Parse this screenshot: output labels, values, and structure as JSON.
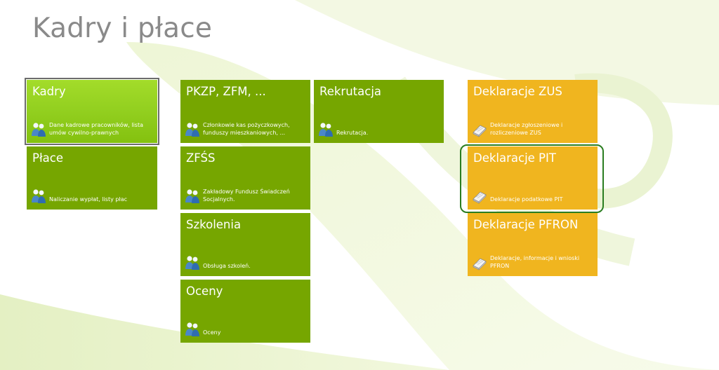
{
  "page": {
    "title": "Kadry i płace"
  },
  "colors": {
    "green_tile": "#76a600",
    "green_tile_active": "#92cf1f",
    "yellow_tile": "#f0b51f",
    "title_text": "#8a8a8a",
    "focus_ring": "#2a7d20"
  },
  "icons": {
    "people": "people-icon",
    "book": "book-icon"
  },
  "tiles": {
    "kadry": {
      "title": "Kadry",
      "desc": "Dane kadrowe pracowników, lista umów cywilno-prawnych"
    },
    "place": {
      "title": "Płace",
      "desc": "Naliczanie wypłat, listy płac"
    },
    "pkzp": {
      "title": "PKZP, ZFM, ...",
      "desc": "Członkowie kas pożyczkowych, funduszy mieszkaniowych, ..."
    },
    "zfss": {
      "title": "ZFŚS",
      "desc": "Zakładowy Fundusz Świadczeń Socjalnych."
    },
    "szkolenia": {
      "title": "Szkolenia",
      "desc": "Obsługa szkoleń."
    },
    "oceny": {
      "title": "Oceny",
      "desc": "Oceny"
    },
    "rekrutacja": {
      "title": "Rekrutacja",
      "desc": "Rekrutacja."
    },
    "zus": {
      "title": "Deklaracje ZUS",
      "desc": "Deklaracje zgłoszeniowe i rozliczeniowe ZUS"
    },
    "pit": {
      "title": "Deklaracje PIT",
      "desc": "Deklaracje podatkowe PIT"
    },
    "pfron": {
      "title": "Deklaracje PFRON",
      "desc": "Deklaracje, informacje i wnioski PFRON"
    }
  }
}
